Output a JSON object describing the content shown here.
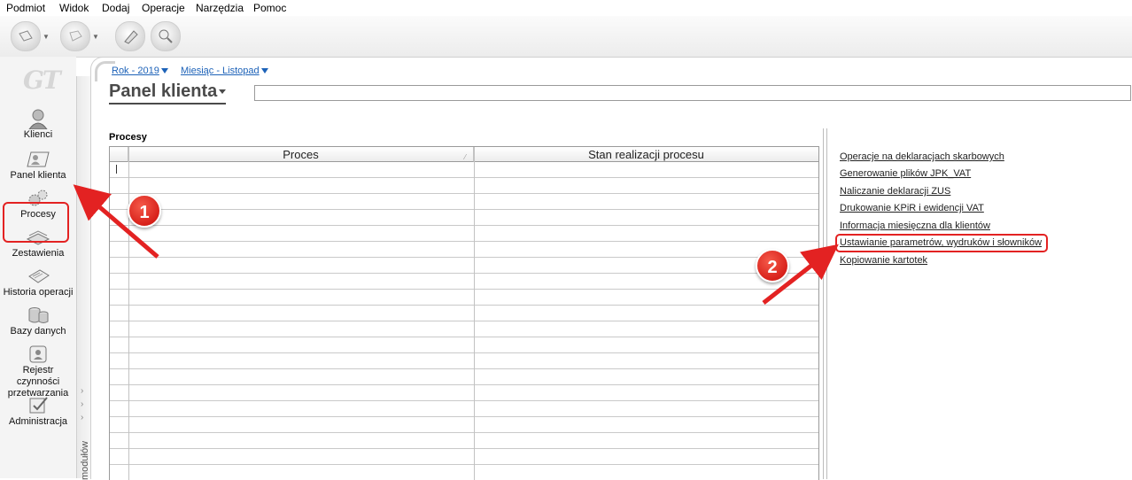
{
  "menu": [
    "Podmiot",
    "Widok",
    "Dodaj",
    "Operacje",
    "Narzędzia",
    "Pomoc"
  ],
  "logo_text": "GT",
  "sidebar": {
    "items": [
      {
        "label": "Klienci",
        "icon": "user-icon"
      },
      {
        "label": "Panel klienta",
        "icon": "card-user-icon"
      },
      {
        "label": "Procesy",
        "icon": "gears-icon"
      },
      {
        "label": "Zestawienia",
        "icon": "stack-icon"
      },
      {
        "label": "Historia operacji",
        "icon": "notepad-icon"
      },
      {
        "label": "Bazy danych",
        "icon": "database-icon"
      },
      {
        "label": "Rejestr czynności",
        "label2": "przetwarzania",
        "icon": "id-card-icon"
      },
      {
        "label": "Administracja",
        "icon": "admin-icon"
      }
    ],
    "module_label": "modułów"
  },
  "breadcrumbs": [
    {
      "label": "Rok - 2019"
    },
    {
      "label": "Miesiąc - Listopad"
    }
  ],
  "page_title": "Panel klienta",
  "section_label": "Procesy",
  "table": {
    "columns": [
      "Proces",
      "Stan realizacji procesu"
    ],
    "rows": []
  },
  "links": [
    "Operacje na deklaracjach skarbowych",
    "Generowanie plików JPK_VAT",
    "Naliczanie deklaracji ZUS",
    "Drukowanie KPiR i ewidencji VAT",
    "Informacja miesięczna dla klientów",
    "Ustawianie parametrów, wydruków i słowników",
    "Kopiowanie kartotek"
  ],
  "annotations": [
    "1",
    "2"
  ],
  "colors": {
    "highlight": "#e32222",
    "link": "#1d62b8"
  }
}
